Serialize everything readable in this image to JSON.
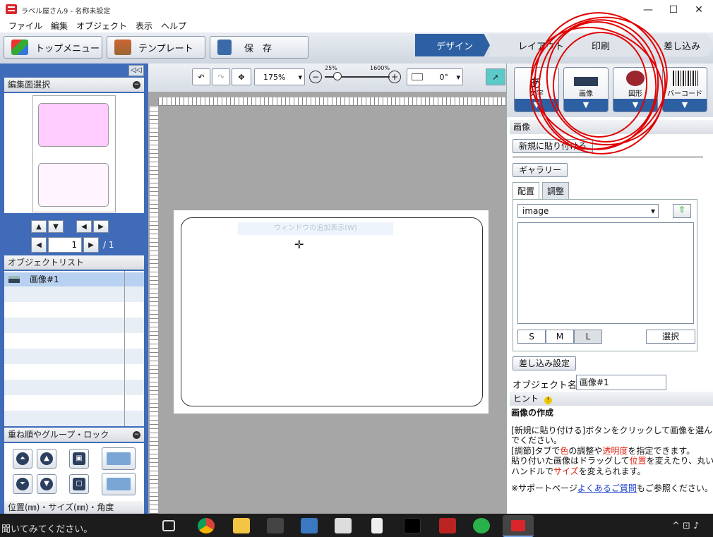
{
  "window": {
    "title": "ラベル屋さん9 - 名称未設定",
    "minimize": "—",
    "maximize": "☐",
    "close": "✕"
  },
  "menubar": [
    "ファイル",
    "編集",
    "オブジェクト",
    "表示",
    "ヘルプ"
  ],
  "toolbar": {
    "top_menu": "トップメニュー",
    "template": "テンプレート",
    "save": "保　存"
  },
  "mode_tabs": [
    "デザイン",
    "レイアウト",
    "印刷",
    "差し込み"
  ],
  "left_panel": {
    "edit_surface_title": "編集面選択",
    "page_current": "1",
    "page_total": "/ 1",
    "object_list_title": "オブジェクトリスト",
    "object_items": [
      "画像#1"
    ],
    "grouping_title": "重ね順やグループ・ロック",
    "position_title": "位置(㎜)・サイズ(㎜)・角度"
  },
  "canvas_toolbar": {
    "zoom": "175%",
    "zoom_min": "25%",
    "zoom_max": "1600%",
    "angle": "0°"
  },
  "canvas": {
    "ghost_text": "ウィンドウの追加表示(W)"
  },
  "right_panel": {
    "tools": [
      {
        "label": "文字"
      },
      {
        "label": "画像"
      },
      {
        "label": "図形"
      },
      {
        "label": "バーコード"
      }
    ],
    "section_title": "画像",
    "paste_new": "新規に貼り付ける",
    "gallery": "ギャラリー",
    "tabs": [
      "配置",
      "調整"
    ],
    "select_value": "image",
    "sizes": [
      "S",
      "M",
      "L"
    ],
    "select_button": "選択",
    "merge_settings": "差し込み設定",
    "object_name_label": "オブジェクト名",
    "object_name_value": "画像#1",
    "hint_title": "ヒント",
    "hint_heading": "画像の作成",
    "hint_line1": "[新規に貼り付ける]ボタンをクリックして画像を選ん",
    "hint_line2": "でください。",
    "hint_line3a": "[調節]タブで",
    "hint_line3b": "色",
    "hint_line3c": "の調整や",
    "hint_line3d": "透明度",
    "hint_line3e": "を指定できます。",
    "hint_line4a": "貼り付いた画像はドラッグして",
    "hint_line4b": "位置",
    "hint_line4c": "を変えたり、丸い",
    "hint_line5a": "ハンドルで",
    "hint_line5b": "サイズ",
    "hint_line5c": "を変えられます。",
    "hint_line6a": "※サポートページ",
    "hint_line6b": "よくあるご質問",
    "hint_line6c": "もご参照ください。"
  },
  "taskbar": {
    "search_text": "聞いてみてください。"
  },
  "colors": {
    "accent_blue": "#2d5fa3",
    "panel_blue": "#3f6bb8",
    "annotation_red": "#e00000",
    "thumb_pink": "#ffccff"
  }
}
